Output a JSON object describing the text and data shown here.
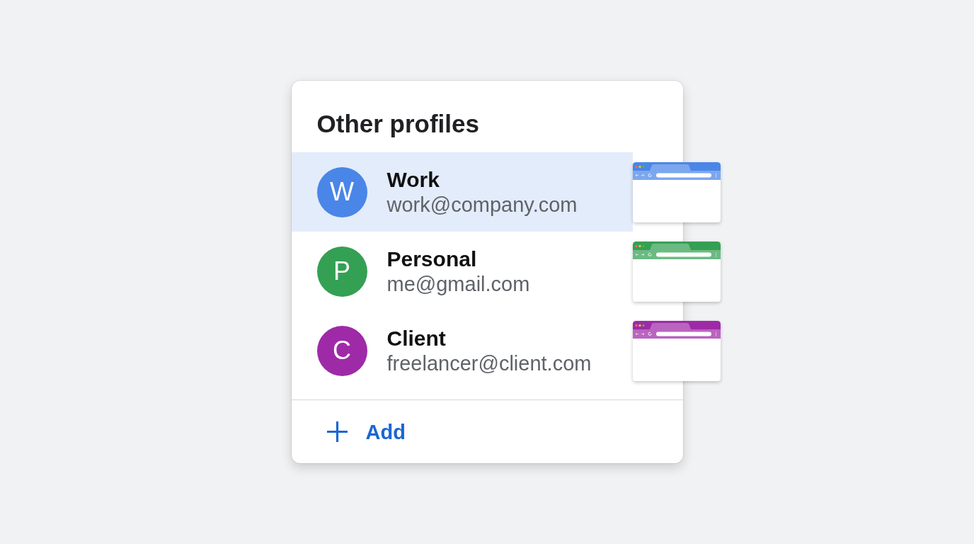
{
  "panel": {
    "title": "Other profiles",
    "profiles": [
      {
        "initial": "W",
        "name": "Work",
        "email": "work@company.com",
        "selected": true,
        "color": "#4a86e8"
      },
      {
        "initial": "P",
        "name": "Personal",
        "email": "me@gmail.com",
        "selected": false,
        "color": "#34a054"
      },
      {
        "initial": "C",
        "name": "Client",
        "email": "freelancer@client.com",
        "selected": false,
        "color": "#9f2aa8"
      }
    ],
    "add_button": {
      "label": "Add"
    }
  }
}
